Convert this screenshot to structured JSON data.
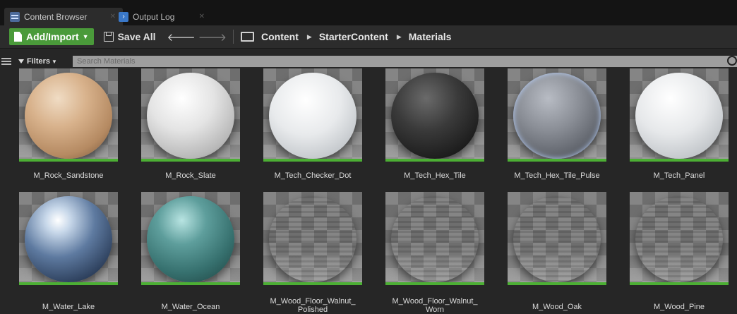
{
  "tabs": [
    {
      "label": "Content Browser",
      "icon": "content-browser-icon"
    },
    {
      "label": "Output Log",
      "icon": "output-log-icon"
    }
  ],
  "toolbar": {
    "add_import_label": "Add/Import",
    "save_all_label": "Save All",
    "breadcrumbs": [
      "Content",
      "StarterContent",
      "Materials"
    ]
  },
  "filterbar": {
    "filters_label": "Filters",
    "search_placeholder": "Search Materials"
  },
  "assets": [
    {
      "name": "M_Rock_Sandstone",
      "line2": ""
    },
    {
      "name": "M_Rock_Slate",
      "line2": ""
    },
    {
      "name": "M_Tech_Checker_Dot",
      "line2": ""
    },
    {
      "name": "M_Tech_Hex_Tile",
      "line2": ""
    },
    {
      "name": "M_Tech_Hex_Tile_Pulse",
      "line2": ""
    },
    {
      "name": "M_Tech_Panel",
      "line2": ""
    },
    {
      "name": "M_Water_Lake",
      "line2": ""
    },
    {
      "name": "M_Water_Ocean",
      "line2": ""
    },
    {
      "name": "M_Wood_Floor_Walnut_",
      "line2": "Polished"
    },
    {
      "name": "M_Wood_Floor_Walnut_",
      "line2": "Worn"
    },
    {
      "name": "M_Wood_Oak",
      "line2": ""
    },
    {
      "name": "M_Wood_Pine",
      "line2": ""
    }
  ],
  "colors": {
    "accent_green": "#4caf34",
    "add_button": "#4a9a3a",
    "background": "#262626"
  }
}
